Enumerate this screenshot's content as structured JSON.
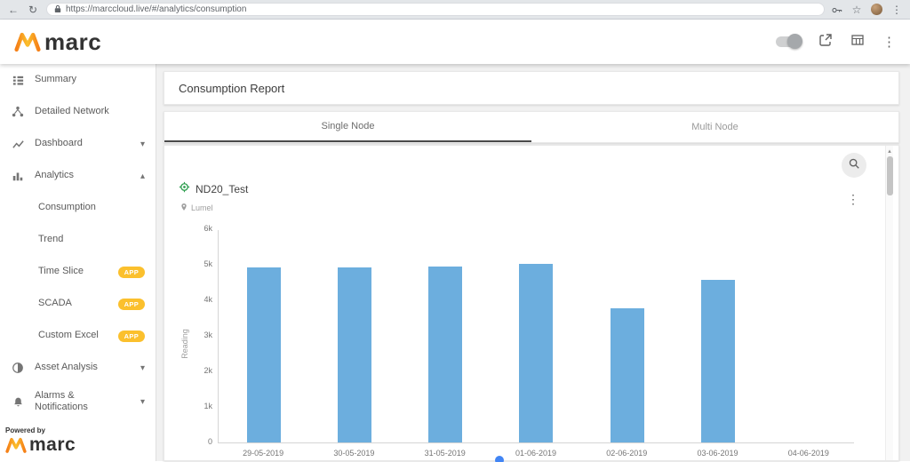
{
  "browser": {
    "url": "https://marccloud.live/#/analytics/consumption"
  },
  "icons": {
    "back": "←",
    "refresh": "↻",
    "star": "☆",
    "kebab": "⋮",
    "caret_down": "▾",
    "caret_up": "▴"
  },
  "header": {
    "logo_text": "marc"
  },
  "sidebar": {
    "items": [
      {
        "label": "Summary"
      },
      {
        "label": "Detailed Network"
      },
      {
        "label": "Dashboard"
      },
      {
        "label": "Analytics"
      },
      {
        "label": "Consumption"
      },
      {
        "label": "Trend"
      },
      {
        "label": "Time Slice",
        "badge": "APP"
      },
      {
        "label": "SCADA",
        "badge": "APP"
      },
      {
        "label": "Custom Excel",
        "badge": "APP"
      },
      {
        "label": "Asset Analysis"
      },
      {
        "label": "Alarms & Notifications"
      }
    ],
    "powered_by": "Powered by",
    "logo_text": "marc"
  },
  "main": {
    "report_title": "Consumption Report",
    "tabs": {
      "single": "Single Node",
      "multi": "Multi Node"
    },
    "node": {
      "name": "ND20_Test",
      "location": "Lumel"
    }
  },
  "chart_data": {
    "type": "bar",
    "title": "",
    "categories": [
      "29-05-2019",
      "30-05-2019",
      "31-05-2019",
      "01-06-2019",
      "02-06-2019",
      "03-06-2019",
      "04-06-2019"
    ],
    "values": [
      4950,
      4940,
      4970,
      5050,
      3780,
      4600,
      0
    ],
    "xlabel": "",
    "ylabel": "Reading",
    "ylim": [
      0,
      6000
    ],
    "yticks": [
      "0",
      "1k",
      "2k",
      "3k",
      "4k",
      "5k",
      "6k"
    ],
    "grid": false,
    "legend_position": "bottom"
  },
  "colors": {
    "bar": "#6caede",
    "badge": "#fbc02d",
    "accent_blue": "#4285f4",
    "logo_dark": "#f57f17",
    "logo_light": "#fbc02d",
    "node_green": "#2e9e4f"
  }
}
